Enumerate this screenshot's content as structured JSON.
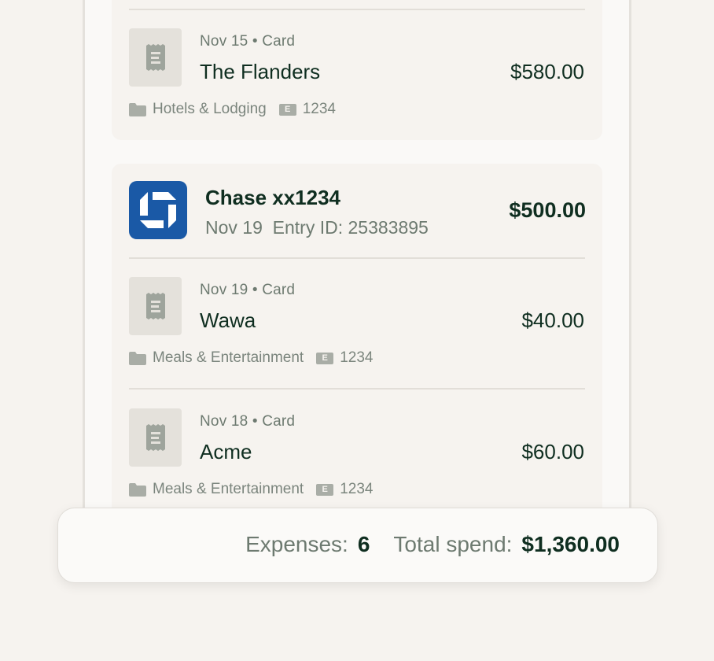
{
  "transactions_top": {
    "meta": "Nov 15 • Card",
    "merchant": "The Flanders",
    "amount": "$580.00",
    "category": "Hotels & Lodging",
    "badge": "E",
    "account": "1234"
  },
  "bank_group": {
    "name": "Chase xx1234",
    "date": "Nov 19",
    "entry_id": "Entry ID: 25383895",
    "total": "$500.00",
    "logo_color": "#1a59a6",
    "items": [
      {
        "meta": "Nov 19 • Card",
        "merchant": "Wawa",
        "amount": "$40.00",
        "category": "Meals & Entertainment",
        "badge": "E",
        "account": "1234"
      },
      {
        "meta": "Nov 18 • Card",
        "merchant": "Acme",
        "amount": "$60.00",
        "category": "Meals & Entertainment",
        "badge": "E",
        "account": "1234"
      }
    ]
  },
  "summary": {
    "expenses_label": "Expenses:",
    "expenses_value": "6",
    "spend_label": "Total spend:",
    "spend_value": "$1,360.00"
  },
  "icons": {
    "receipt": "receipt-icon",
    "folder": "folder-icon",
    "bank_logo": "chase-logo-icon"
  }
}
